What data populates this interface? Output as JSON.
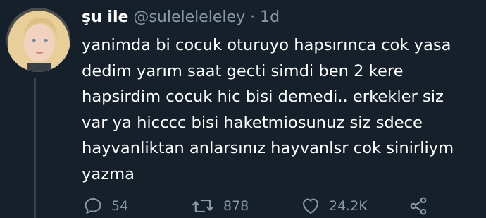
{
  "tweet": {
    "display_name": "şu ile",
    "handle": "@suleleleleley",
    "separator": "·",
    "time": "1d",
    "text_lines": [
      "yanimda bi cocuk oturuyo hapsırınca cok yasa",
      "dedim yarım saat gecti simdi ben 2 kere",
      "hapsirdim cocuk hic bisi demedi.. erkekler siz",
      "var ya hicccc bisi haketmiosunuz siz sdece",
      "hayvanliktan anlarsınız hayvanlsr cok sinirliym",
      "yazma"
    ]
  },
  "actions": {
    "reply": {
      "icon": "reply-icon",
      "count": "54"
    },
    "retweet": {
      "icon": "retweet-icon",
      "count": "878"
    },
    "like": {
      "icon": "heart-icon",
      "count": "24.2K"
    },
    "share": {
      "icon": "share-icon",
      "count": ""
    }
  },
  "colors": {
    "background": "#15202b",
    "primary_text": "#ffffff",
    "secondary_text": "#8899a6",
    "thread_line": "#38444d"
  }
}
